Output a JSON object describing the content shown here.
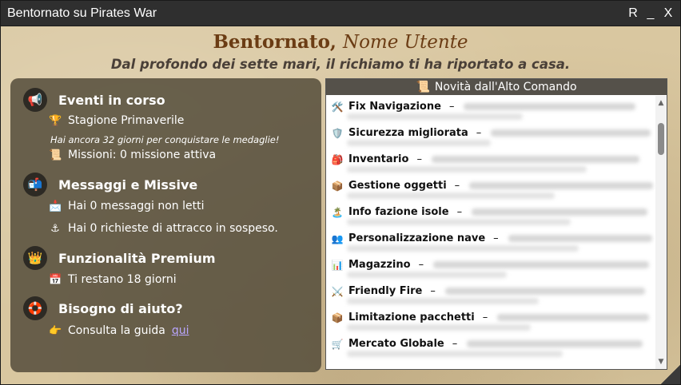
{
  "window": {
    "title": "Bentornato su Pirates War",
    "controls": {
      "r": "R",
      "minimize": "_",
      "close": "X"
    }
  },
  "header": {
    "welcome": "Bentornato,",
    "username": "Nome Utente",
    "subtitle": "Dal profondo dei sette mari, il richiamo ti ha riportato a casa."
  },
  "sections": {
    "events": {
      "title": "Eventi in corso",
      "season": "Stagione Primaverile",
      "note": "Hai ancora 32 giorni per conquistare le medaglie!",
      "missions": "Missioni: 0 missione attiva"
    },
    "messages": {
      "title": "Messaggi e Missive",
      "unread": "Hai 0 messaggi non letti",
      "docking": "Hai 0 richieste di attracco in sospeso."
    },
    "premium": {
      "title": "Funzionalità Premium",
      "days": "Ti restano 18 giorni"
    },
    "help": {
      "title": "Bisogno di aiuto?",
      "text": "Consulta la guida",
      "link": "qui"
    }
  },
  "news": {
    "header": "Novità dall'Alto Comando",
    "items": [
      {
        "title": "Fix Navigazione",
        "icon": "tools-icon"
      },
      {
        "title": "Sicurezza migliorata",
        "icon": "shield-icon"
      },
      {
        "title": "Inventario",
        "icon": "backpack-icon"
      },
      {
        "title": "Gestione oggetti",
        "icon": "box-icon"
      },
      {
        "title": "Info fazione isole",
        "icon": "island-icon"
      },
      {
        "title": "Personalizzazione nave",
        "icon": "people-icon"
      },
      {
        "title": "Magazzino",
        "icon": "chart-icon"
      },
      {
        "title": "Friendly Fire",
        "icon": "swords-icon"
      },
      {
        "title": "Limitazione pacchetti",
        "icon": "package-icon"
      },
      {
        "title": "Mercato Globale",
        "icon": "cart-icon"
      }
    ]
  },
  "colors": {
    "heading": "#6b3c14",
    "panel": "#58503e",
    "titlebar": "#2f2f2f",
    "link": "#b9a6ff"
  }
}
